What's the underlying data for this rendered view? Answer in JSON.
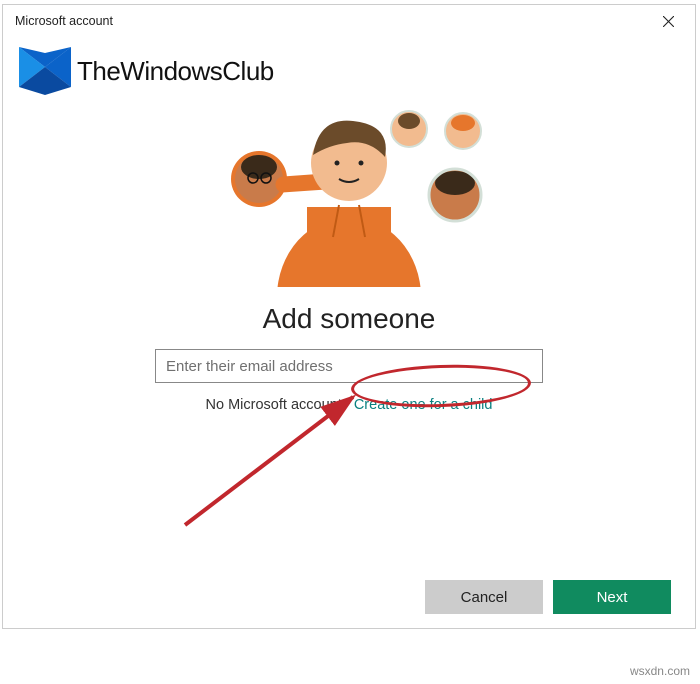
{
  "titlebar": {
    "title": "Microsoft account"
  },
  "watermark": {
    "text": "TheWindowsClub"
  },
  "main": {
    "heading": "Add someone",
    "email_placeholder": "Enter their email address",
    "email_value": "",
    "no_account_text": "No Microsoft account?",
    "create_child_link": "Create one for a child"
  },
  "footer": {
    "cancel_label": "Cancel",
    "next_label": "Next"
  },
  "site_credit": "wsxdn.com",
  "colors": {
    "accent_green": "#108b5f",
    "link_teal": "#0a8080",
    "annot_red": "#c1272d"
  }
}
